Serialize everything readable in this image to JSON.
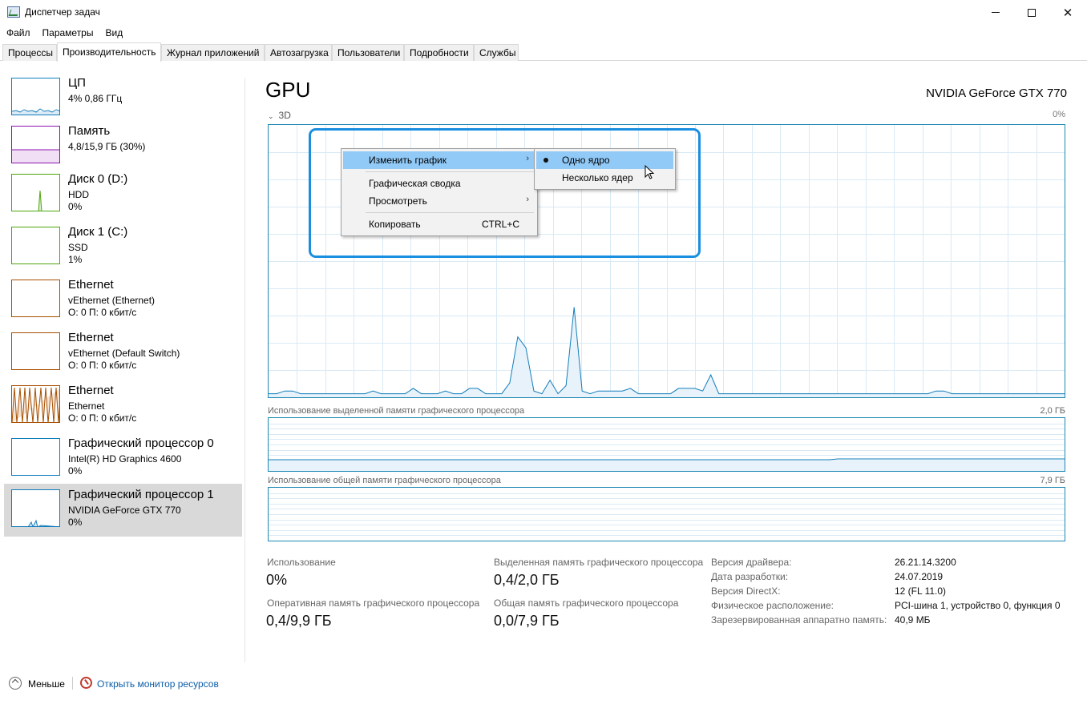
{
  "window": {
    "title": "Диспетчер задач",
    "minimize": "—",
    "maximize": "☐",
    "close": "✕"
  },
  "menu": [
    "Файл",
    "Параметры",
    "Вид"
  ],
  "tabs": [
    {
      "label": "Процессы"
    },
    {
      "label": "Производительность",
      "active": true
    },
    {
      "label": "Журнал приложений"
    },
    {
      "label": "Автозагрузка"
    },
    {
      "label": "Пользователи"
    },
    {
      "label": "Подробности"
    },
    {
      "label": "Службы"
    }
  ],
  "resources": [
    {
      "title": "ЦП",
      "line1": "4% 0,86 ГГц",
      "line2": "",
      "color": "#117dbb"
    },
    {
      "title": "Память",
      "line1": "4,8/15,9 ГБ (30%)",
      "line2": "",
      "color": "#8b12ae"
    },
    {
      "title": "Диск 0 (D:)",
      "line1": "HDD",
      "line2": "0%",
      "color": "#4da60c"
    },
    {
      "title": "Диск 1 (C:)",
      "line1": "SSD",
      "line2": "1%",
      "color": "#4da60c"
    },
    {
      "title": "Ethernet",
      "line1": "vEthernet (Ethernet)",
      "line2": "О: 0 П: 0 кбит/с",
      "color": "#a74f01"
    },
    {
      "title": "Ethernet",
      "line1": "vEthernet (Default Switch)",
      "line2": "О: 0 П: 0 кбит/с",
      "color": "#a74f01"
    },
    {
      "title": "Ethernet",
      "line1": "Ethernet",
      "line2": "О: 0 П: 0 кбит/с",
      "color": "#a74f01"
    },
    {
      "title": "Графический процессор 0",
      "line1": "Intel(R) HD Graphics 4600",
      "line2": "0%",
      "color": "#117dbb"
    },
    {
      "title": "Графический процессор 1",
      "line1": "NVIDIA GeForce GTX 770",
      "line2": "0%",
      "color": "#117dbb",
      "selected": true
    }
  ],
  "gpu": {
    "title": "GPU",
    "name": "NVIDIA GeForce GTX 770",
    "engine_label": "3D",
    "engine_chevron": "⌄",
    "engine_max": "0%",
    "dedicated_label": "Использование выделенной памяти графического процессора",
    "dedicated_max": "2,0 ГБ",
    "shared_label": "Использование общей памяти графического процессора",
    "shared_max": "7,9 ГБ"
  },
  "chart_data": {
    "type": "area",
    "series": [
      {
        "values": [
          1,
          1,
          2,
          2,
          1,
          1,
          1,
          1,
          1,
          1,
          1,
          1,
          1,
          2,
          1,
          1,
          1,
          1,
          3,
          1,
          1,
          1,
          2,
          1,
          1,
          3,
          3,
          1,
          1,
          1,
          5,
          22,
          18,
          2,
          1,
          6,
          1,
          4,
          33,
          2,
          1,
          2,
          2,
          2,
          2,
          3,
          1,
          1,
          1,
          1,
          1,
          3,
          3,
          3,
          2,
          8,
          1,
          1,
          1,
          1,
          1,
          1,
          1,
          1,
          1,
          1,
          1,
          1,
          1,
          1,
          1,
          1,
          1,
          1,
          1,
          1,
          1,
          1,
          1,
          1,
          1,
          1,
          1,
          2,
          2,
          1,
          1,
          1,
          1,
          1,
          1,
          1,
          1,
          1,
          1,
          1,
          1,
          1,
          1,
          1
        ]
      }
    ],
    "ylim": [
      0,
      100
    ]
  },
  "stats": {
    "usage_label": "Использование",
    "usage_value": "0%",
    "dedicated_label": "Выделенная память графического процессора",
    "dedicated_value": "0,4/2,0 ГБ",
    "ram_label": "Оперативная память графического процессора",
    "ram_value": "0,4/9,9 ГБ",
    "shared_label": "Общая память графического процессора",
    "shared_value": "0,0/7,9 ГБ"
  },
  "details": [
    {
      "key": "Версия драйвера:",
      "value": "26.21.14.3200"
    },
    {
      "key": "Дата разработки:",
      "value": "24.07.2019"
    },
    {
      "key": "Версия DirectX:",
      "value": "12 (FL 11.0)"
    },
    {
      "key": "Физическое расположение:",
      "value": "PCI-шина 1, устройство 0, функция 0"
    },
    {
      "key": "Зарезервированная аппаратно память:",
      "value": "40,9 МБ"
    }
  ],
  "context_menu": {
    "items": [
      {
        "label": "Изменить график",
        "arrow": "›"
      },
      {
        "label": "Графическая сводка"
      },
      {
        "label": "Просмотреть",
        "arrow": "›"
      },
      {
        "label": "Копировать",
        "shortcut": "CTRL+C"
      }
    ],
    "submenu": [
      {
        "label": "Одно ядро",
        "checked": true
      },
      {
        "label": "Несколько ядер"
      }
    ]
  },
  "footer": {
    "less": "Меньше",
    "monitor": "Открыть монитор ресурсов"
  }
}
